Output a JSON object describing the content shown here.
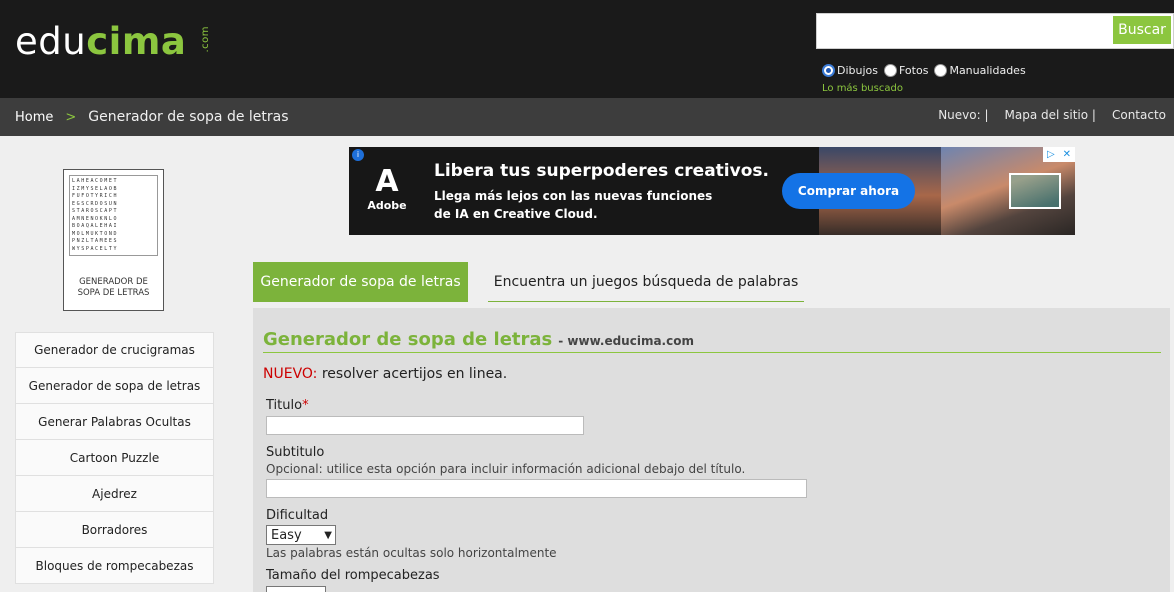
{
  "header": {
    "logo_part1": "edu",
    "logo_part2": "cima",
    "logo_part3": ".com",
    "search_placeholder": "",
    "search_button": "Buscar",
    "radios": [
      {
        "label": "Dibujos",
        "checked": true
      },
      {
        "label": "Fotos",
        "checked": false
      },
      {
        "label": "Manualidades",
        "checked": false
      }
    ],
    "popular_link": "Lo más buscado"
  },
  "navbar": {
    "home": "Home",
    "separator": ">",
    "current": "Generador de sopa de letras",
    "links": [
      "Nuevo: |",
      "Mapa del sitio |",
      "Contacto"
    ]
  },
  "sidebar": {
    "thumb_rows": [
      "LAHEACOMET",
      "IZMYSELAOB",
      "FUFOTYRICH",
      "EGSCRDOSUN",
      "STAROSCAPT",
      "AMNENOKNLO",
      "BOAQALEHAI",
      "MOLMUKTOND",
      "PNZLTAMEES",
      "WYSPACELTY"
    ],
    "thumb_label_1": "GENERADOR DE",
    "thumb_label_2": "SOPA DE LETRAS",
    "menu": [
      "Generador de crucigramas",
      "Generador de sopa de letras",
      "Generar Palabras Ocultas",
      "Cartoon Puzzle",
      "Ajedrez",
      "Borradores",
      "Bloques de rompecabezas"
    ]
  },
  "ad": {
    "brand": "Adobe",
    "headline": "Libera tus superpoderes creativos.",
    "sub1": "Llega más lejos con las nuevas funciones",
    "sub2": "de IA en Creative Cloud.",
    "cta": "Comprar ahora"
  },
  "tabs": {
    "active": "Generador de sopa de letras",
    "inactive": "Encuentra un juegos búsqueda de palabras"
  },
  "form": {
    "title": "Generador de sopa de letras",
    "site": "- www.educima.com",
    "nuevo_label": "NUEVO:",
    "nuevo_text": " resolver acertijos en linea.",
    "titulo_label": "Titulo",
    "required_mark": "*",
    "subtitulo_label": "Subtitulo",
    "subtitulo_help": "Opcional: utilice esta opción para incluir información adicional debajo del título.",
    "dificultad_label": "Dificultad",
    "dificultad_value": "Easy",
    "dificultad_help": "Las palabras están ocultas solo horizontalmente",
    "tamano_label": "Tamaño del rompecabezas"
  }
}
